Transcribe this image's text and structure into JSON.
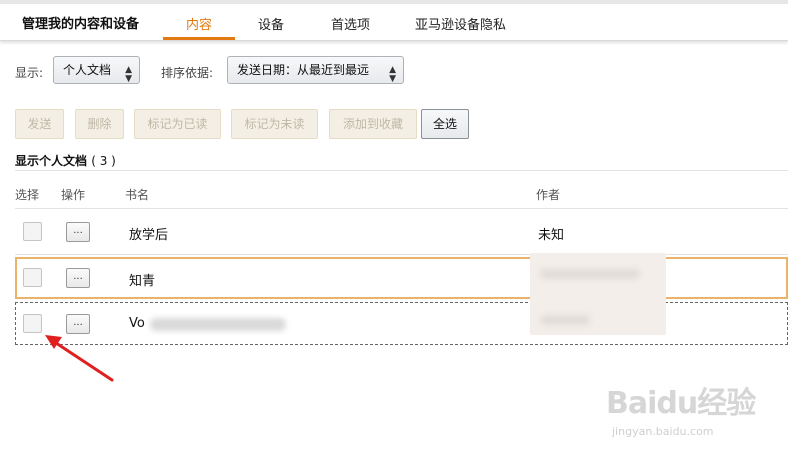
{
  "nav": {
    "title": "管理我的内容和设备",
    "tabs": [
      "内容",
      "设备",
      "首选项",
      "亚马逊设备隐私"
    ],
    "active_index": 0,
    "accent_color": "#e47911"
  },
  "filters": {
    "show_label": "显示:",
    "show_value": "个人文档",
    "sort_label": "排序依据:",
    "sort_value": "发送日期：从最近到最远"
  },
  "actions": {
    "send": "发送",
    "delete": "删除",
    "mark_read": "标记为已读",
    "mark_unread": "标记为未读",
    "add_collection": "添加到收藏",
    "select_all": "全选"
  },
  "list": {
    "heading": "显示个人文档",
    "count": "( 3 )",
    "columns": {
      "select": "选择",
      "action": "操作",
      "title": "书名",
      "author": "作者"
    },
    "more_label": "...",
    "rows": [
      {
        "title": "放学后",
        "author": "未知"
      },
      {
        "title": "知青",
        "author": ""
      },
      {
        "title": "Vo",
        "author": ""
      }
    ]
  },
  "watermark": {
    "brand": "Baidu经验",
    "url": "jingyan.baidu.com"
  }
}
